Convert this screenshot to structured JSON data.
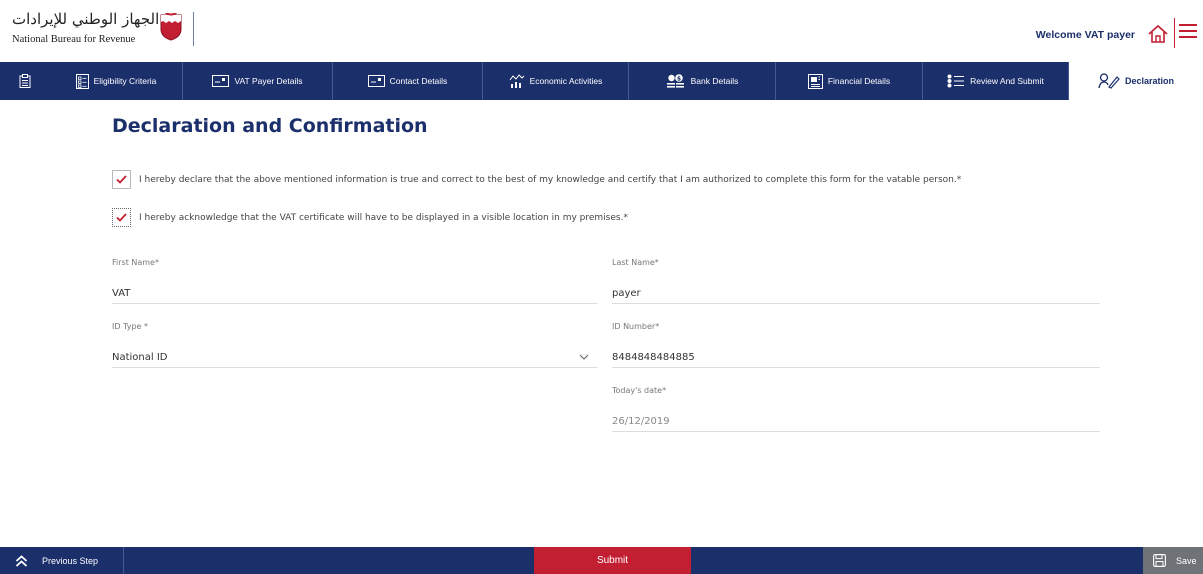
{
  "header": {
    "logo_arabic": "الجهاز الوطني للإيرادات",
    "logo_english": "National Bureau for Revenue",
    "welcome_text": "Welcome VAT payer"
  },
  "steps": [
    {
      "label": "Eligibility Criteria",
      "icon": "checklist-icon"
    },
    {
      "label": "VAT Payer Details",
      "icon": "id-card-icon"
    },
    {
      "label": "Contact Details",
      "icon": "id-card-icon"
    },
    {
      "label": "Economic Activities",
      "icon": "chart-icon"
    },
    {
      "label": "Bank Details",
      "icon": "bank-icon"
    },
    {
      "label": "Financial Details",
      "icon": "financial-icon"
    },
    {
      "label": "Review And Submit",
      "icon": "list-icon"
    },
    {
      "label": "Declaration",
      "icon": "signature-icon",
      "active": true
    }
  ],
  "page": {
    "title": "Declaration and Confirmation"
  },
  "declarations": [
    {
      "text": "I hereby declare that the above mentioned information is true and correct to the best of my knowledge and certify that I am authorized to complete this form for the vatable person.*",
      "checked": true
    },
    {
      "text": "I hereby acknowledge that the VAT certificate will have to be displayed in a visible location in my premises.*",
      "checked": true
    }
  ],
  "form": {
    "first_name": {
      "label": "First Name*",
      "value": "VAT"
    },
    "last_name": {
      "label": "Last Name*",
      "value": "payer"
    },
    "id_type": {
      "label": "ID Type *",
      "value": "National ID"
    },
    "id_number": {
      "label": "ID Number*",
      "value": "8484848484885"
    },
    "todays_date": {
      "label": "Today's date*",
      "value": "26/12/2019"
    }
  },
  "footer": {
    "previous_label": "Previous Step",
    "submit_label": "Submit",
    "save_label": "Save"
  },
  "colors": {
    "navy": "#1b2f6b",
    "accent_red": "#c21f32",
    "save_gray": "#6f7377"
  }
}
